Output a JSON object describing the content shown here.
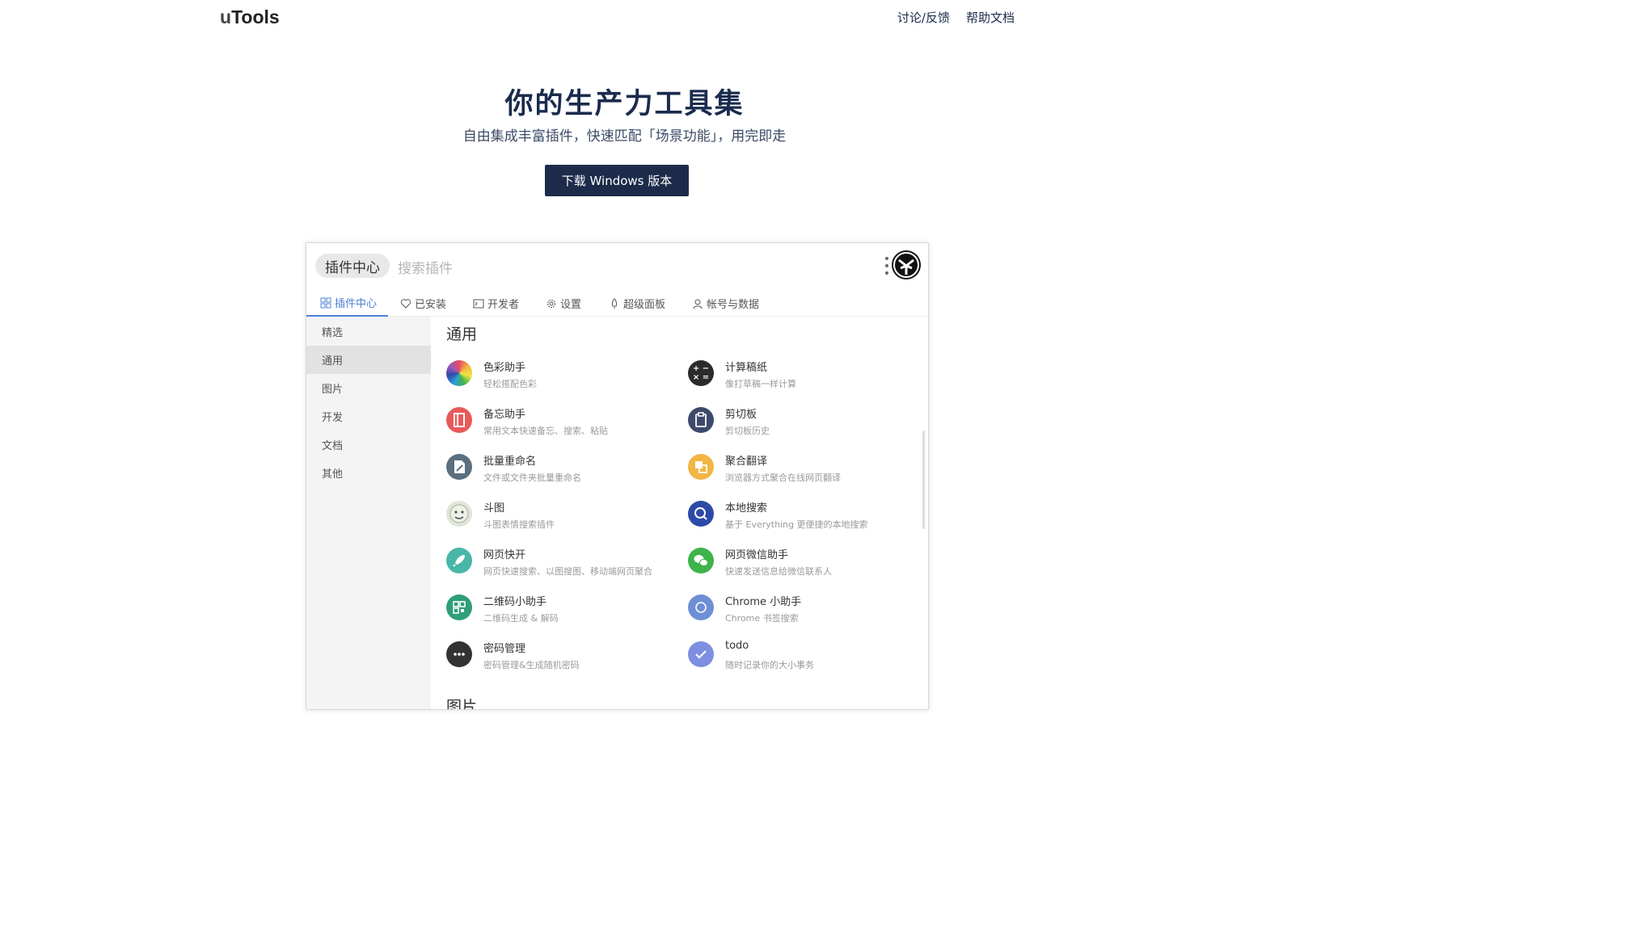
{
  "header": {
    "logo_u": "u",
    "logo_rest": "Tools",
    "nav": [
      "讨论/反馈",
      "帮助文档"
    ]
  },
  "hero": {
    "title": "你的生产力工具集",
    "subtitle": "自由集成丰富插件，快速匹配「场景功能」，用完即走",
    "download_label": "下载 Windows 版本"
  },
  "app": {
    "chip_label": "插件中心",
    "search_placeholder": "搜索插件",
    "tabs": [
      {
        "label": "插件中心",
        "icon": "grid-icon"
      },
      {
        "label": "已安装",
        "icon": "heart-icon"
      },
      {
        "label": "开发者",
        "icon": "terminal-icon"
      },
      {
        "label": "设置",
        "icon": "gear-icon"
      },
      {
        "label": "超级面板",
        "icon": "rocket-icon"
      },
      {
        "label": "帐号与数据",
        "icon": "user-icon"
      }
    ],
    "sidebar": [
      "精选",
      "通用",
      "图片",
      "开发",
      "文档",
      "其他"
    ],
    "sidebar_active": "通用",
    "section_title": "通用",
    "next_section_title": "图片",
    "plugins": [
      {
        "name": "色彩助手",
        "desc": "轻松搭配色彩",
        "icon": "color-wheel-icon",
        "color": "#e84a5f"
      },
      {
        "name": "计算稿纸",
        "desc": "像打草稿一样计算",
        "icon": "calculator-icon",
        "color": "#2b2b2b"
      },
      {
        "name": "备忘助手",
        "desc": "常用文本快速备忘、搜索、粘贴",
        "icon": "notebook-icon",
        "color": "#e85a5a"
      },
      {
        "name": "剪切板",
        "desc": "剪切板历史",
        "icon": "clipboard-icon",
        "color": "#3d4a6b"
      },
      {
        "name": "批量重命名",
        "desc": "文件或文件夹批量重命名",
        "icon": "edit-file-icon",
        "color": "#5b6f7f"
      },
      {
        "name": "聚合翻译",
        "desc": "浏览器方式聚合在线网页翻译",
        "icon": "translate-icon",
        "color": "#f2b544"
      },
      {
        "name": "斗图",
        "desc": "斗图表情搜索插件",
        "icon": "meme-face-icon",
        "color": "#cfd9c8"
      },
      {
        "name": "本地搜索",
        "desc": "基于 Everything 更便捷的本地搜索",
        "icon": "search-icon",
        "color": "#2d4aa8"
      },
      {
        "name": "网页快开",
        "desc": "网页快速搜索、以图搜图、移动端网页聚合",
        "icon": "rocket-icon",
        "color": "#49b6a8"
      },
      {
        "name": "网页微信助手",
        "desc": "快速发送信息给微信联系人",
        "icon": "wechat-icon",
        "color": "#3db34a"
      },
      {
        "name": "二维码小助手",
        "desc": "二维码生成 & 解码",
        "icon": "qrcode-icon",
        "color": "#2f9e7a"
      },
      {
        "name": "Chrome 小助手",
        "desc": "Chrome 书签搜索",
        "icon": "chrome-icon",
        "color": "#6e8fd6"
      },
      {
        "name": "密码管理",
        "desc": "密码管理&生成随机密码",
        "icon": "password-icon",
        "color": "#333333"
      },
      {
        "name": "todo",
        "desc": "随时记录你的大小事务",
        "icon": "check-icon",
        "color": "#7d8fe0"
      }
    ]
  }
}
